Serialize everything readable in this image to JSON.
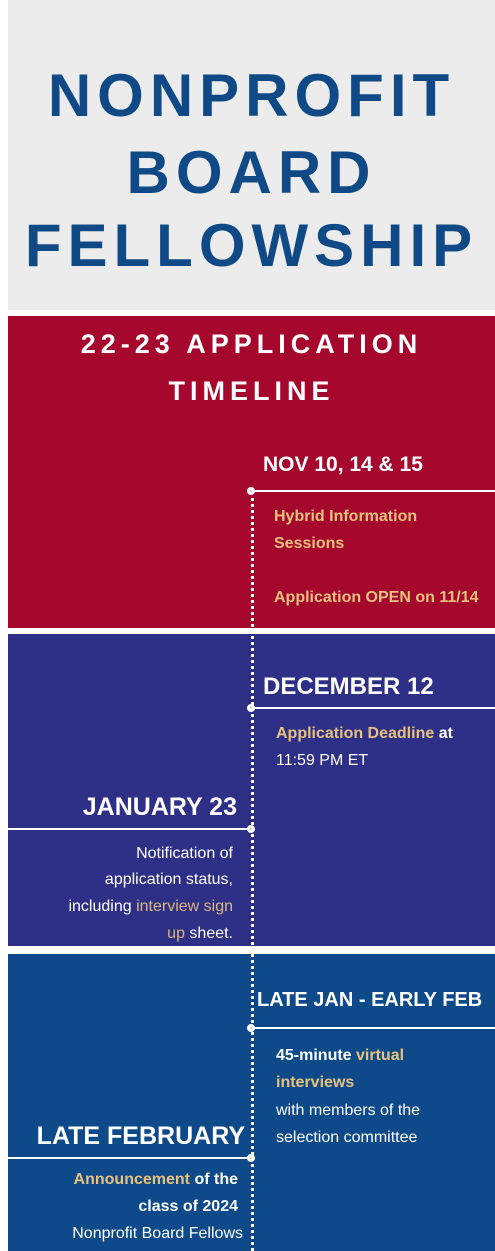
{
  "title": {
    "line1": "NONPROFIT",
    "line2": "BOARD",
    "line3": "FELLOWSHIP"
  },
  "subtitle": {
    "line1": "22-23 APPLICATION",
    "line2": "TIMELINE"
  },
  "events": {
    "nov": {
      "date": "NOV 10, 14 & 15",
      "line1": "Hybrid Information",
      "line2": "Sessions",
      "line3": "Application OPEN on 11/14"
    },
    "dec": {
      "date": "DECEMBER 12",
      "highlight": "Application Deadline",
      "tail": " at",
      "line2": "11:59 PM ET"
    },
    "jan23": {
      "date": "JANUARY 23",
      "line1": "Notification of",
      "line2": "application status,",
      "line3_pre": "including ",
      "line3_link": "interview sign",
      "line4_link": "up",
      "line4_post": " sheet."
    },
    "latejan": {
      "date": "LATE JAN - EARLY FEB",
      "line1_pre": "45-minute ",
      "line1_link": "virtual",
      "line2_link": "interviews",
      "line3": "with members of the",
      "line4": "selection committee"
    },
    "latefeb": {
      "date": "LATE FEBRUARY",
      "line1_link": "Announcement",
      "line1_post": " of the",
      "line2": "class of 2024",
      "line3": "Nonprofit Board Fellows"
    }
  },
  "colors": {
    "title_blue": "#0f4a87",
    "red_band": "#a5072d",
    "indigo_band": "#2e2f86",
    "blue_band": "#0e4a89",
    "gold_accent": "#e7c27d"
  }
}
